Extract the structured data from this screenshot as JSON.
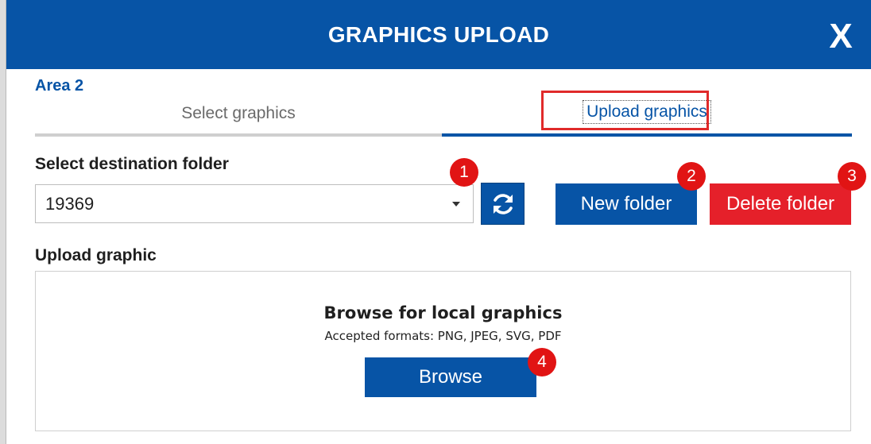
{
  "dialog": {
    "title": "GRAPHICS UPLOAD",
    "close_label": "X"
  },
  "area_label": "Area 2",
  "tabs": [
    {
      "label": "Select graphics",
      "active": false
    },
    {
      "label": "Upload graphics",
      "active": true
    }
  ],
  "destination": {
    "label": "Select destination folder",
    "selected_value": "19369"
  },
  "buttons": {
    "new_folder": "New folder",
    "delete_folder": "Delete folder",
    "browse": "Browse"
  },
  "upload": {
    "label": "Upload graphic",
    "title": "Browse for local graphics",
    "formats": "Accepted formats: PNG, JPEG, SVG, PDF"
  },
  "callouts": [
    "1",
    "2",
    "3",
    "4"
  ],
  "colors": {
    "primary": "#0754a6",
    "danger": "#e5202a",
    "callout": "#e11414",
    "highlight": "#e02a2a"
  },
  "icons": {
    "refresh": "refresh-icon",
    "dropdown": "chevron-down-icon"
  }
}
